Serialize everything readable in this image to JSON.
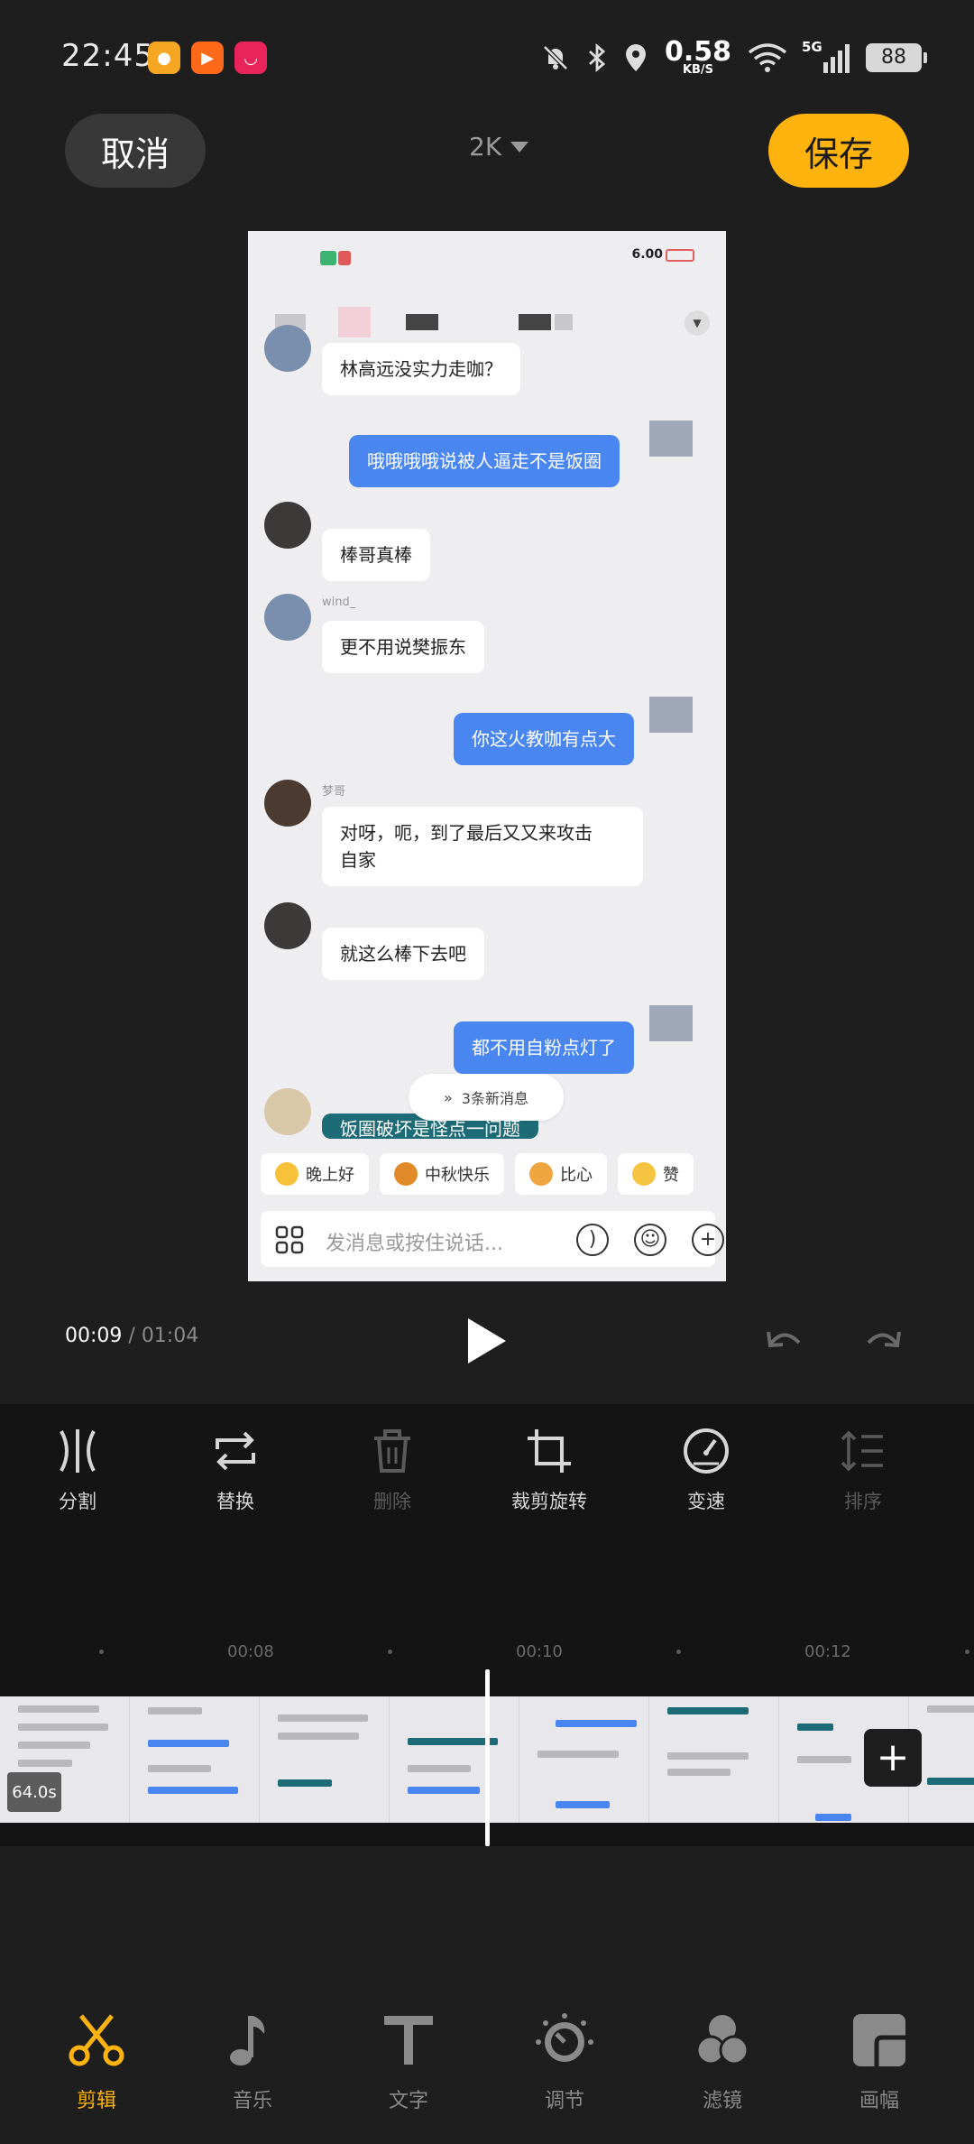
{
  "status_bar": {
    "time": "22:45",
    "apps": [
      {
        "name": "weibo-icon",
        "color": "#f5a623"
      },
      {
        "name": "kuaishou-icon",
        "color": "#ff6a1a"
      },
      {
        "name": "app-icon",
        "color": "#e8245a"
      }
    ],
    "net_speed": "0.58",
    "net_unit": "KB/S",
    "network": "5G",
    "battery": "88"
  },
  "top_bar": {
    "cancel_label": "取消",
    "resolution": "2K",
    "save_label": "保存"
  },
  "preview": {
    "status_speed": "6.00",
    "messages": [
      {
        "side": "left",
        "text": "林高远没实力走咖？"
      },
      {
        "side": "right",
        "text": "哦哦哦哦说被人逼走不是饭圈"
      },
      {
        "side": "left",
        "text": "棒哥真棒"
      },
      {
        "side": "left",
        "sender": "wind_",
        "text": "更不用说樊振东"
      },
      {
        "side": "right",
        "text": "你这火教咖有点大"
      },
      {
        "side": "left",
        "sender": "梦哥",
        "text": "对呀，呃，到了最后又又来攻击\n自家"
      },
      {
        "side": "left",
        "text": "就这么棒下去吧"
      },
      {
        "side": "right",
        "text": "都不用自粉点灯了"
      },
      {
        "side": "left",
        "text": "饭圈破坏是怪点一问题"
      }
    ],
    "new_messages": "3条新消息",
    "quick_replies": [
      "晚上好",
      "中秋快乐",
      "比心",
      "赞"
    ],
    "input_placeholder": "发消息或按住说话..."
  },
  "playback": {
    "current": "00:09",
    "separator": " / ",
    "total": "01:04"
  },
  "tools": [
    {
      "label": "分割",
      "icon": "split-icon",
      "enabled": true
    },
    {
      "label": "替换",
      "icon": "replace-icon",
      "enabled": true
    },
    {
      "label": "删除",
      "icon": "delete-icon",
      "enabled": false
    },
    {
      "label": "裁剪旋转",
      "icon": "crop-icon",
      "enabled": true
    },
    {
      "label": "变速",
      "icon": "speed-icon",
      "enabled": true
    },
    {
      "label": "排序",
      "icon": "sort-icon",
      "enabled": false
    }
  ],
  "timeline": {
    "ticks": [
      "00:08",
      "00:10",
      "00:12"
    ],
    "clip_duration": "64.0s"
  },
  "bottom_nav": [
    {
      "label": "剪辑",
      "icon": "scissors-icon",
      "active": true
    },
    {
      "label": "音乐",
      "icon": "music-note-icon",
      "active": false
    },
    {
      "label": "文字",
      "icon": "text-icon",
      "active": false
    },
    {
      "label": "调节",
      "icon": "adjust-dial-icon",
      "active": false
    },
    {
      "label": "滤镜",
      "icon": "filter-icon",
      "active": false
    },
    {
      "label": "画幅",
      "icon": "aspect-ratio-icon",
      "active": false
    }
  ],
  "colors": {
    "accent": "#ffb30f",
    "bubble_blue": "#4a86f0",
    "background": "#1e1e1e"
  }
}
